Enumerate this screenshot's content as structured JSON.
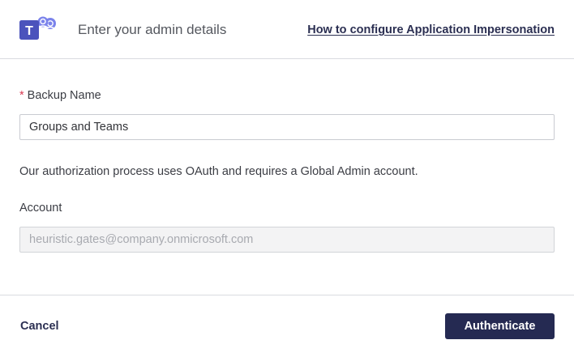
{
  "header": {
    "logo_icon": "microsoft-teams-logo",
    "logo_letter": "T",
    "title": "Enter your admin details",
    "help_link": "How to configure Application Impersonation"
  },
  "form": {
    "backup_name": {
      "required_marker": "*",
      "label": "Backup Name",
      "value": "Groups and Teams"
    },
    "info_text": "Our authorization process uses OAuth and requires a Global Admin account.",
    "account": {
      "label": "Account",
      "placeholder": "heuristic.gates@company.onmicrosoft.com"
    }
  },
  "footer": {
    "cancel_label": "Cancel",
    "authenticate_label": "Authenticate"
  },
  "colors": {
    "primary": "#252a52",
    "required": "#d83a52",
    "teams_purple": "#5059c9"
  }
}
